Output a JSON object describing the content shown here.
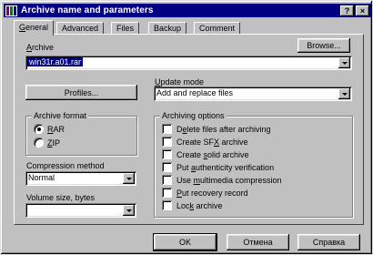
{
  "window": {
    "title": "Archive name and parameters",
    "help_button": "?",
    "close_button": "×"
  },
  "tabs": [
    "General",
    "Advanced",
    "Files",
    "Backup",
    "Comment"
  ],
  "archive": {
    "label": "Archive",
    "label_rest": "rchive",
    "label_key": "A",
    "value": "win31r.a01.rar",
    "browse_label": "Browse..."
  },
  "update_mode": {
    "label": "Update mode",
    "label_key": "U",
    "label_rest": "pdate mode",
    "value": "Add and replace files"
  },
  "profiles_label": "Profiles...",
  "archive_format": {
    "legend": "Archive format",
    "options": [
      {
        "label": "RAR",
        "key": "R",
        "rest": "AR",
        "selected": true
      },
      {
        "label": "ZIP",
        "key": "Z",
        "rest": "IP",
        "selected": false
      }
    ]
  },
  "compression": {
    "label": "Compression method",
    "value": "Normal"
  },
  "volume": {
    "label": "Volume size, bytes",
    "value": ""
  },
  "archiving_options": {
    "legend": "Archiving options",
    "items": [
      {
        "pre": "D",
        "key": "e",
        "post": "lete files after archiving",
        "checked": false
      },
      {
        "pre": "Create SF",
        "key": "X",
        "post": " archive",
        "checked": false
      },
      {
        "pre": "Create ",
        "key": "s",
        "post": "olid archive",
        "checked": false
      },
      {
        "pre": "Put ",
        "key": "a",
        "post": "uthenticity verification",
        "checked": false
      },
      {
        "pre": "Use ",
        "key": "m",
        "post": "ultimedia compression",
        "checked": false
      },
      {
        "pre": "",
        "key": "P",
        "post": "ut recovery record",
        "checked": false
      },
      {
        "pre": "Loc",
        "key": "k",
        "post": " archive",
        "checked": false
      }
    ]
  },
  "footer": {
    "ok": "OK",
    "cancel": "Отмена",
    "help": "Справка"
  }
}
